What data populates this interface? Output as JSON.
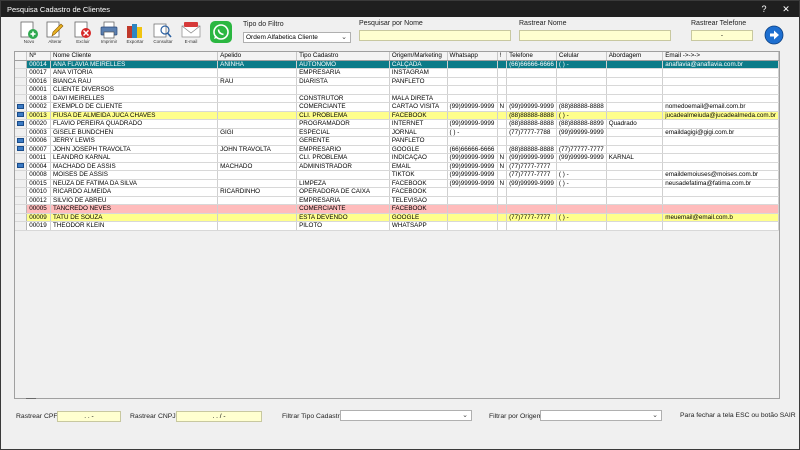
{
  "window": {
    "title": "Pesquisa Cadastro de Clientes",
    "help": "?",
    "close": "✕"
  },
  "toolbar": {
    "buttons": [
      {
        "name": "novo-button",
        "label": "Novo"
      },
      {
        "name": "alterar-button",
        "label": "Alterar"
      },
      {
        "name": "excluir-button",
        "label": "Excluir"
      },
      {
        "name": "imprimir-button",
        "label": "Imprimir"
      },
      {
        "name": "exportar-button",
        "label": "Exportar"
      },
      {
        "name": "consultar-button",
        "label": "Consultar"
      },
      {
        "name": "email-button",
        "label": "E-mail"
      },
      {
        "name": "whatsapp-button",
        "label": ""
      }
    ],
    "tipo_filtro_label": "Tipo do Filtro",
    "tipo_filtro_value": "Ordem Alfabetica Cliente",
    "pesquisar_label": "Pesquisar por Nome",
    "pesquisar_value": "",
    "rastrear_nome_label": "Rastrear Nome",
    "rastrear_nome_value": "",
    "rastrear_telefone_label": "Rastrear Telefone",
    "rastrear_telefone_value": "-"
  },
  "grid": {
    "columns": [
      "Nº",
      "Nome Cliente",
      "Apelido",
      "Tipo Cadastro",
      "Origem/Marketing",
      "Whatsapp",
      "!",
      "Telefone",
      "Celular",
      "Abordagem",
      "Email ->->->"
    ],
    "rows": [
      {
        "style": "sel",
        "icon": false,
        "cells": [
          "00014",
          "ANA FLAVIA MEIRELLES",
          "ANINHA",
          "AUTONOMO",
          "CALÇADA",
          "",
          "",
          "(66)66666-6666",
          "( )   -",
          "",
          "anaflavia@anaflavia.com.br"
        ]
      },
      {
        "style": "norm",
        "icon": false,
        "cells": [
          "00017",
          "ANA VITÓRIA",
          "",
          "EMPRESARIA",
          "INSTAGRAM",
          "",
          "",
          "",
          "",
          "",
          ""
        ]
      },
      {
        "style": "norm",
        "icon": false,
        "cells": [
          "00016",
          "BIANCA RAU",
          "RAU",
          "DIARISTA",
          "PANFLETO",
          "",
          "",
          "",
          "",
          "",
          ""
        ]
      },
      {
        "style": "norm",
        "icon": false,
        "cells": [
          "00001",
          "CLIENTE DIVERSOS",
          "",
          "",
          "",
          "",
          "",
          "",
          "",
          "",
          ""
        ]
      },
      {
        "style": "norm",
        "icon": false,
        "cells": [
          "00018",
          "DAVI MEIRELLES",
          "",
          "CONSTRUTOR",
          "MALA DIRETA",
          "",
          "",
          "",
          "",
          "",
          ""
        ]
      },
      {
        "style": "norm",
        "icon": true,
        "cells": [
          "00002",
          "EXEMPLO DE CLIENTE",
          "",
          "COMERCIANTE",
          "CARTÃO VISITA",
          "(99)99999-9999",
          "N",
          "(99)99999-9999",
          "(88)88888-8888",
          "",
          "nomedoemail@email.com.br"
        ]
      },
      {
        "style": "yel",
        "icon": true,
        "cells": [
          "00013",
          "FIUSA DE ALMEIDA JUCA CHAVES",
          "",
          "CLI. PROBLEMA",
          "FACEBOOK",
          "",
          "",
          "(88)88888-8888",
          "( )   -",
          "",
          "jucadealmeiuda@jucadealmeda.com.br"
        ]
      },
      {
        "style": "norm",
        "icon": true,
        "cells": [
          "00020",
          "FLAVIO PEREIRA QUADRADO",
          "",
          "PROGRAMADOR",
          "INTERNET",
          "(99)99999-9999",
          "",
          "(88)88888-8888",
          "(88)88888-8899",
          "Quadrado",
          ""
        ]
      },
      {
        "style": "norm",
        "icon": false,
        "cells": [
          "00003",
          "GISELE BUNDCHEN",
          "GIGI",
          "ESPECIAL",
          "JORNAL",
          "( )   -",
          "",
          "(77)7777-7788",
          "(99)99999-9999",
          "",
          "emaildagigi@gigi.com.br"
        ]
      },
      {
        "style": "norm",
        "icon": true,
        "cells": [
          "00006",
          "JERRY LEWIS",
          "",
          "GERENTE",
          "PANFLETO",
          "",
          "",
          "",
          "",
          "",
          ""
        ]
      },
      {
        "style": "norm",
        "icon": true,
        "cells": [
          "00007",
          "JOHN JOSEPH TRAVOLTA",
          "JOHN TRAVOLTA",
          "EMPRESARIO",
          "GOOGLE",
          "(66)66666-6666",
          "",
          "(88)88888-8888",
          "(77)77777-7777",
          "",
          ""
        ]
      },
      {
        "style": "norm",
        "icon": false,
        "cells": [
          "00011",
          "LEANDRO KARNAL",
          "",
          "CLI. PROBLEMA",
          "INDICAÇÃO",
          "(99)99999-9999",
          "N",
          "(99)99999-9999",
          "(99)99999-9999",
          "KARNAL",
          ""
        ]
      },
      {
        "style": "norm",
        "icon": true,
        "cells": [
          "00004",
          "MACHADO DE ASSIS",
          "MACHADO",
          "ADMINISTRADOR",
          "EMAIL",
          "(99)99999-9999",
          "N",
          "(77)7777-7777",
          "",
          "",
          ""
        ]
      },
      {
        "style": "norm",
        "icon": false,
        "cells": [
          "00008",
          "MOISES DE ASSIS",
          "",
          "",
          "TIKTOK",
          "(99)99999-9999",
          "",
          "(77)7777-7777",
          "( )   -",
          "",
          "emaildemoiuses@moises.com.br"
        ]
      },
      {
        "style": "norm",
        "icon": false,
        "cells": [
          "00015",
          "NEUZA DE FATIMA DA SILVA",
          "",
          "LIMPEZA",
          "FACEBOOK",
          "(99)99999-9999",
          "N",
          "(99)99999-9999",
          "( )   -",
          "",
          "neusadefatima@fatima.com.br"
        ]
      },
      {
        "style": "norm",
        "icon": false,
        "cells": [
          "00010",
          "RICARDO ALMEIDA",
          "RICARDINHO",
          "OPERADORA DE CAIXA",
          "FACEBOOK",
          "",
          "",
          "",
          "",
          "",
          ""
        ]
      },
      {
        "style": "norm",
        "icon": false,
        "cells": [
          "00012",
          "SILVIO DE ABREU",
          "",
          "EMPRESARIA",
          "TELEVISÃO",
          "",
          "",
          "",
          "",
          "",
          ""
        ]
      },
      {
        "style": "pink",
        "icon": false,
        "cells": [
          "00005",
          "TANCREDO NEVES",
          "",
          "COMERCIANTE",
          "FACEBOOK",
          "",
          "",
          "",
          "",
          "",
          ""
        ]
      },
      {
        "style": "yel",
        "icon": false,
        "cells": [
          "00009",
          "TATU DE SOUZA",
          "",
          "ESTA DEVENDO",
          "GOOGLE",
          "",
          "",
          "(77)7777-7777",
          "( )   -",
          "",
          "meuemail@email.com.b"
        ]
      },
      {
        "style": "norm",
        "icon": false,
        "cells": [
          "00019",
          "THEODOR KLEIN",
          "",
          "PILOTO",
          "WHATSAPP",
          "",
          "",
          "",
          "",
          "",
          ""
        ]
      }
    ]
  },
  "footer": {
    "rastrear_cpf_label": "Rastrear CPF",
    "rastrear_cpf_value": ". . -",
    "rastrear_cnpj_label": "Rastrear CNPJ",
    "rastrear_cnpj_value": ". . / -",
    "filtrar_tipo_label": "Filtrar Tipo Cadastro",
    "filtrar_tipo_value": "",
    "filtrar_origem_label": "Filtrar por Origem",
    "filtrar_origem_value": "",
    "hint": "Para fechar a tela ESC ou botão SAIR"
  },
  "colors": {
    "selection": "#0c7b88",
    "highlight_yellow": "#ffff8c",
    "highlight_pink": "#ffbcbc",
    "input_bg": "#ffffd0"
  },
  "icons": {
    "row_marker": "card-icon",
    "go": "arrow-right-circle-icon"
  }
}
